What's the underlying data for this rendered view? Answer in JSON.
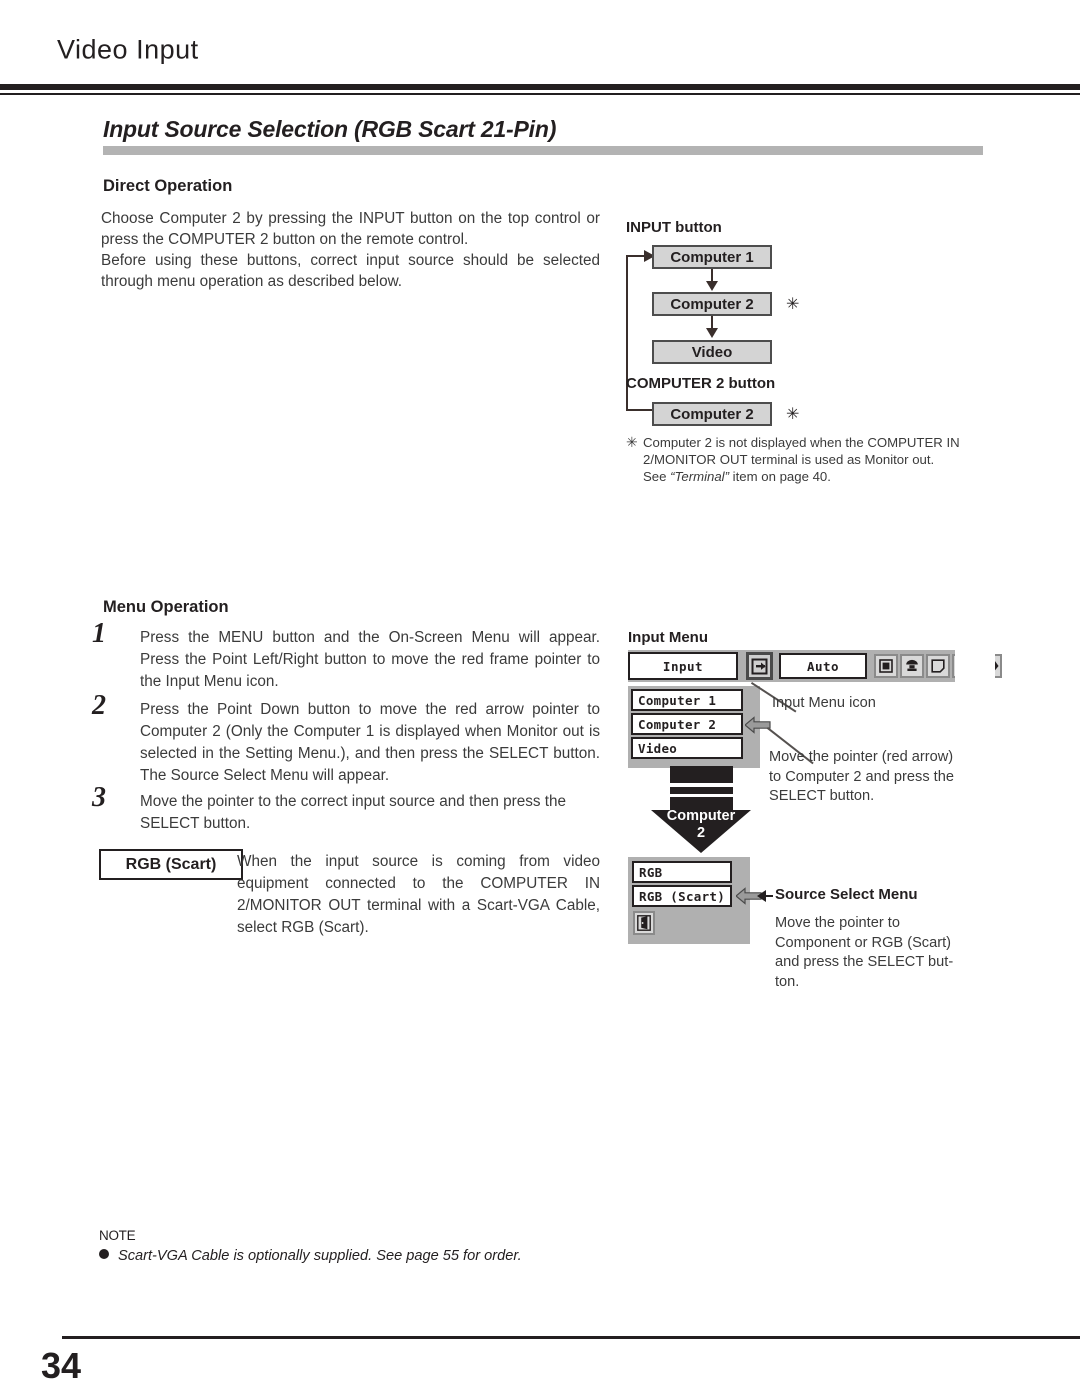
{
  "page": {
    "chapter": "Video Input",
    "section_title": "Input Source Selection (RGB Scart 21-Pin)",
    "page_number": "34"
  },
  "direct_operation": {
    "heading": "Direct Operation",
    "para1": "Choose Computer 2 by pressing the INPUT button on the top control or press the COMPUTER 2 button on the remote control.",
    "para2": "Before using these buttons, correct input source should be selected through menu operation as described below."
  },
  "input_button_diagram": {
    "title": "INPUT button",
    "boxes": [
      {
        "label": "Computer 1",
        "asterisk": ""
      },
      {
        "label": "Computer 2",
        "asterisk": "✳"
      },
      {
        "label": "Video",
        "asterisk": ""
      }
    ],
    "computer2_button_title": "COMPUTER 2 button",
    "computer2_box": {
      "label": "Computer 2",
      "asterisk": "✳"
    },
    "footnote_mark": "✳",
    "footnote_line1": "Computer 2 is not displayed when the COMPUTER IN",
    "footnote_line2": "2/MONITOR OUT terminal is used as Monitor out.",
    "footnote_line3_pre": "See ",
    "footnote_line3_em": "“Terminal”",
    "footnote_line3_post": " item on page 40."
  },
  "menu_operation": {
    "heading": "Menu Operation",
    "steps": [
      {
        "number": "1",
        "text": "Press the MENU button and the On-Screen Menu will appear. Press the Point Left/Right button to move the red frame pointer to the Input Menu icon."
      },
      {
        "number": "2",
        "text": "Press the Point Down button to move the red arrow pointer to Computer 2 (Only the Computer 1 is displayed when Monitor out is selected in the Setting Menu.), and then press the SELECT button.  The Source Select Menu will appear."
      },
      {
        "number": "3",
        "text": "Move the pointer to the correct input source and then press the SELECT button."
      }
    ],
    "scart_callout": {
      "label": "RGB (Scart)",
      "text": "When the input source is coming from video equipment connected to the COMPUTER IN 2/MONITOR OUT terminal with a Scart-VGA Cable, select RGB (Scart)."
    }
  },
  "input_menu_mock": {
    "title": "Input Menu",
    "field_label": "Input",
    "auto_label": "Auto",
    "menu_icon_name": "input-menu-icon",
    "toolbar_icons": [
      "input-menu-icon",
      "screen-square-icon",
      "image-palette-icon",
      "screen-page-icon",
      "sound-speaker-icon",
      "screen-setting-icon"
    ],
    "items": [
      "Computer 1",
      "Computer 2",
      "Video"
    ],
    "callout_icon": "Input Menu icon",
    "callout_pointer_line1": "Move the pointer (red arrow)",
    "callout_pointer_line2": "to Computer 2 and press the",
    "callout_pointer_line3": "SELECT button.",
    "big_arrow_line1": "Computer",
    "big_arrow_line2": "2"
  },
  "source_select_mock": {
    "items": [
      "RGB",
      "RGB (Scart)"
    ],
    "exit_icon": "exit-door-icon",
    "title": "Source Select Menu",
    "caption_line1": "Move the pointer to",
    "caption_line2": "Component or RGB (Scart)",
    "caption_line3": "and press the SELECT but-",
    "caption_line4": "ton."
  },
  "note": {
    "title": "NOTE",
    "text": "Scart-VGA Cable is optionally supplied.  See page 55 for order."
  },
  "colors": {
    "ink": "#231f20",
    "body_text": "#3b3b3b",
    "rule_gray": "#b3b3b3",
    "menu_gray": "#b0b0b0",
    "button_gray": "#d4d4d4"
  }
}
